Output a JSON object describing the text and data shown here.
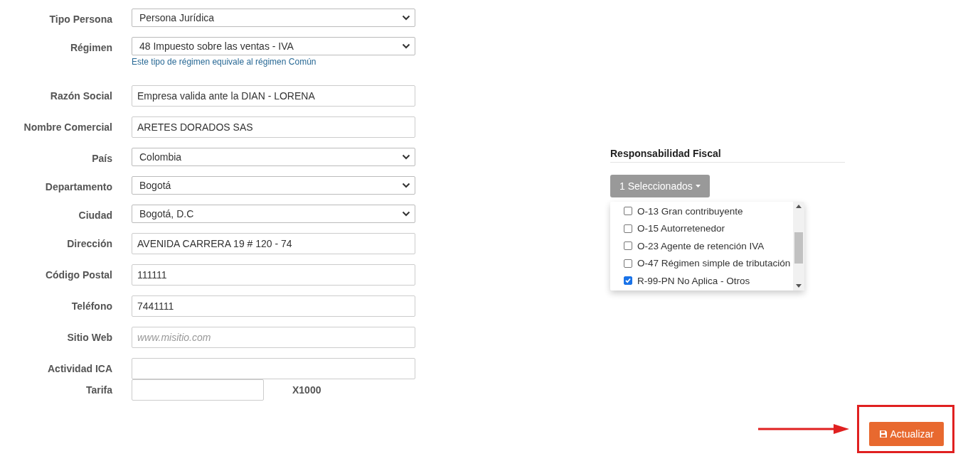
{
  "form": {
    "fields": [
      {
        "kind": "select",
        "label": "Tipo Persona",
        "value": "Persona Jurídica"
      },
      {
        "kind": "select",
        "label": "Régimen",
        "value": "48 Impuesto sobre las ventas - IVA",
        "help": "Este tipo de régimen equivale al régimen Común"
      },
      {
        "kind": "input",
        "label": "Razón Social",
        "value": "Empresa valida ante la DIAN - LORENA"
      },
      {
        "kind": "input",
        "label": "Nombre Comercial",
        "value": "ARETES DORADOS SAS"
      },
      {
        "kind": "select",
        "label": "País",
        "value": "Colombia"
      },
      {
        "kind": "select",
        "label": "Departamento",
        "value": "Bogotá"
      },
      {
        "kind": "select",
        "label": "Ciudad",
        "value": "Bogotá, D.C"
      },
      {
        "kind": "input",
        "label": "Dirección",
        "value": "AVENIDA CARRERA 19 # 120 - 74"
      },
      {
        "kind": "input",
        "label": "Código Postal",
        "value": "111111"
      },
      {
        "kind": "input",
        "label": "Teléfono",
        "value": "7441111"
      },
      {
        "kind": "input",
        "label": "Sitio Web",
        "placeholder": "www.misitio.com"
      },
      {
        "kind": "input",
        "label": "Actividad ICA"
      },
      {
        "kind": "short",
        "label": "Tarifa",
        "suffix": "X1000"
      }
    ]
  },
  "fiscal": {
    "title": "Responsabilidad Fiscal",
    "button": "1 Seleccionados",
    "options": [
      {
        "label": "O-13 Gran contribuyente",
        "checked": false
      },
      {
        "label": "O-15 Autorretenedor",
        "checked": false
      },
      {
        "label": "O-23 Agente de retención IVA",
        "checked": false
      },
      {
        "label": "O-47 Régimen simple de tributación",
        "checked": false
      },
      {
        "label": "R-99-PN No Aplica - Otros",
        "checked": true
      }
    ]
  },
  "save_button": "Actualizar"
}
